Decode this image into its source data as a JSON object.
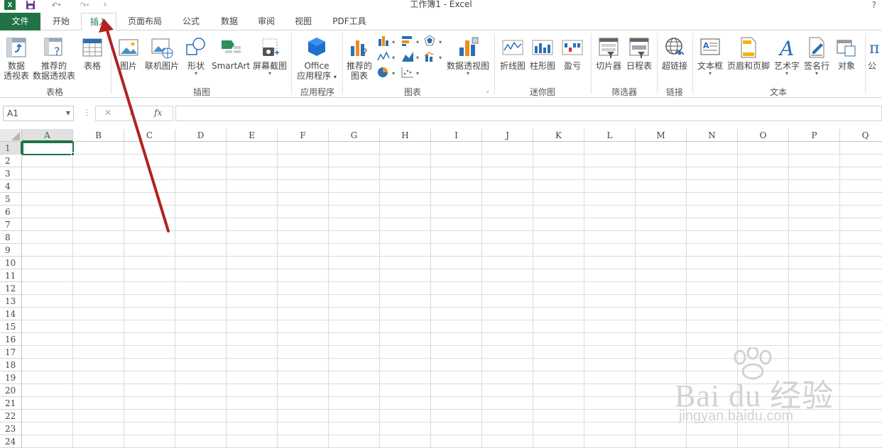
{
  "title": "工作簿1 - Excel",
  "help": "?",
  "qat": {
    "logo": "X"
  },
  "tabs": [
    "文件",
    "开始",
    "插入",
    "页面布局",
    "公式",
    "数据",
    "审阅",
    "视图",
    "PDF工具"
  ],
  "ribbon": {
    "pivot_table": [
      "数据",
      "透视表"
    ],
    "recommended_pivot": [
      "推荐的",
      "数据透视表"
    ],
    "table": "表格",
    "picture": "图片",
    "online_picture": "联机图片",
    "shapes": "形状",
    "smartart": "SmartArt",
    "screenshot": "屏幕截图",
    "office_apps": [
      "Office",
      "应用程序"
    ],
    "recommended_charts": [
      "推荐的",
      "图表"
    ],
    "pivot_chart": "数据透视图",
    "sparkline_line": "折线图",
    "sparkline_column": "柱形图",
    "sparkline_winloss": "盈亏",
    "slicer": "切片器",
    "timeline": "日程表",
    "hyperlink": "超链接",
    "textbox": "文本框",
    "header_footer": "页眉和页脚",
    "wordart": "艺术字",
    "signature": "签名行",
    "object": "对象",
    "symbol": "公",
    "groups": {
      "tables": "表格",
      "illustrations": "插图",
      "apps": "应用程序",
      "charts": "图表",
      "sparklines": "迷你图",
      "filters": "筛选器",
      "links": "链接",
      "text": "文本"
    }
  },
  "formula_bar": {
    "name_box": "A1",
    "fx": "fx",
    "cancel": "✕",
    "enter": "✓"
  },
  "columns": [
    "A",
    "B",
    "C",
    "D",
    "E",
    "F",
    "G",
    "H",
    "I",
    "J",
    "K",
    "L",
    "M",
    "N",
    "O",
    "P",
    "Q"
  ],
  "rows": [
    "1",
    "2",
    "3",
    "4",
    "5",
    "6",
    "7",
    "8",
    "9",
    "10",
    "11",
    "12",
    "13",
    "14",
    "15",
    "16",
    "17",
    "18",
    "19",
    "20",
    "21",
    "22",
    "23",
    "24"
  ],
  "watermark": {
    "brand": "Bai du 经验",
    "url": "jingyan.baidu.com"
  },
  "colors": {
    "accent": "#217346",
    "arrow": "#b22222"
  }
}
